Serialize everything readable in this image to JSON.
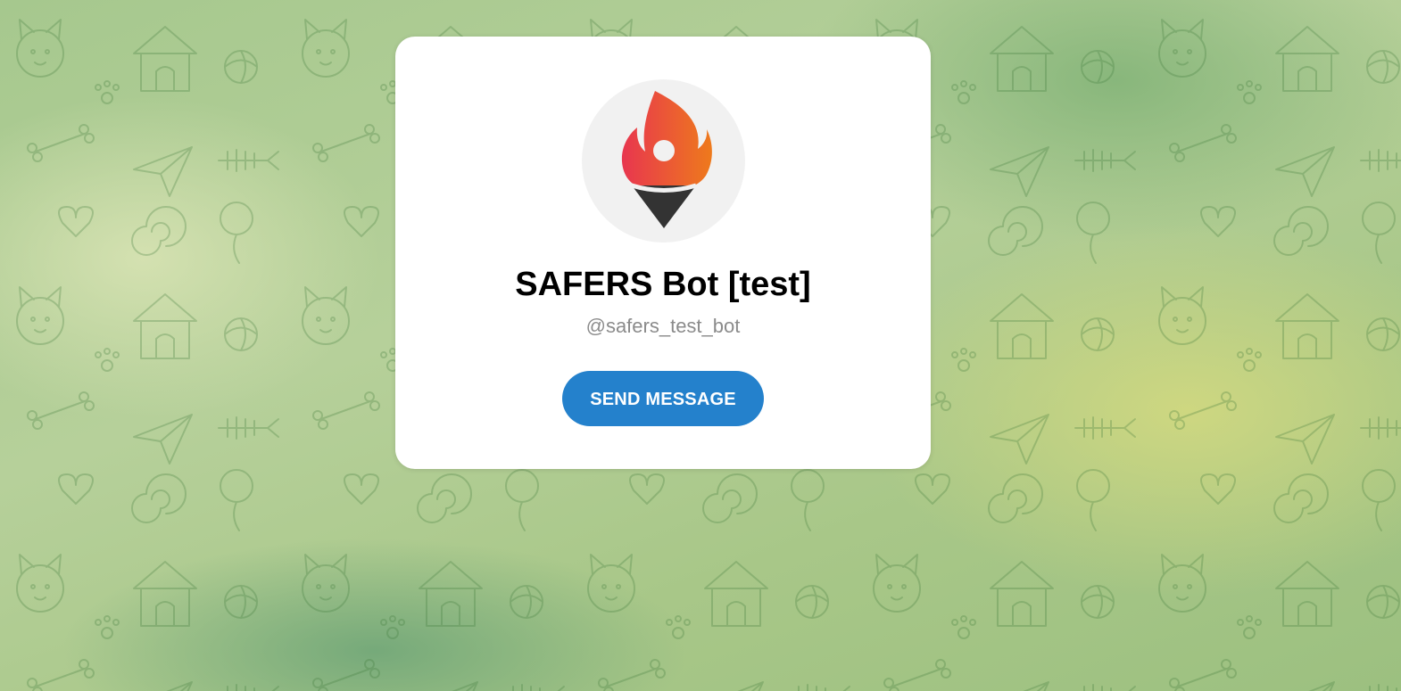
{
  "bot": {
    "name": "SAFERS Bot [test]",
    "username": "@safers_test_bot",
    "avatar_icon": "flame-location-pin-icon"
  },
  "actions": {
    "send_message_label": "SEND MESSAGE"
  },
  "colors": {
    "accent": "#2481cc",
    "card_background": "#ffffff",
    "username_text": "#8b8b8b",
    "flame_start": "#e8364f",
    "flame_end": "#ee7a1c",
    "pin_dark": "#333333"
  }
}
